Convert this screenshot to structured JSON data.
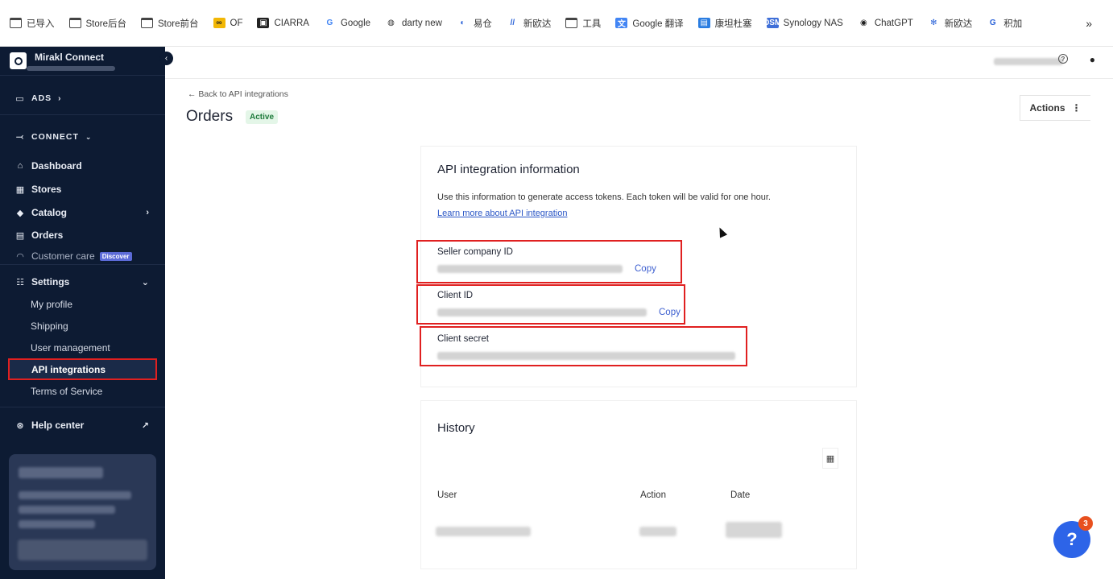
{
  "bookmarks": [
    {
      "label": "已导入",
      "icon": "folder-icon"
    },
    {
      "label": "Store后台",
      "icon": "folder-icon"
    },
    {
      "label": "Store前台",
      "icon": "folder-icon"
    },
    {
      "label": "OF",
      "icon": "of-logo-icon"
    },
    {
      "label": "CIARRA",
      "icon": "ciarra-logo-icon"
    },
    {
      "label": "Google",
      "icon": "google-logo-icon"
    },
    {
      "label": "darty new",
      "icon": "globe-icon"
    },
    {
      "label": "易仓",
      "icon": "yicang-logo-icon"
    },
    {
      "label": "新欧达",
      "icon": "xinouda-logo-icon"
    },
    {
      "label": "工具",
      "icon": "folder-icon"
    },
    {
      "label": "Google 翻译",
      "icon": "google-translate-icon"
    },
    {
      "label": "康坦杜塞",
      "icon": "contact-card-icon"
    },
    {
      "label": "Synology NAS",
      "icon": "synology-logo-icon"
    },
    {
      "label": "ChatGPT",
      "icon": "chatgpt-logo-icon"
    },
    {
      "label": "新欧达",
      "icon": "asterisk-logo-icon"
    },
    {
      "label": "积加",
      "icon": "jijia-logo-icon"
    }
  ],
  "bookmarks_more": "»",
  "brand": {
    "name": "Mirakl Connect"
  },
  "sidebar": {
    "ads": "ADS",
    "connect": "CONNECT",
    "items": [
      {
        "label": "Dashboard",
        "icon": "home-icon"
      },
      {
        "label": "Stores",
        "icon": "store-icon"
      },
      {
        "label": "Catalog",
        "icon": "tag-icon"
      },
      {
        "label": "Orders",
        "icon": "clipboard-icon"
      },
      {
        "label": "Customer care",
        "icon": "headset-icon",
        "badge": "Discover"
      },
      {
        "label": "Settings",
        "icon": "sliders-icon"
      }
    ],
    "settings_sub": [
      "My profile",
      "Shipping",
      "User management",
      "API integrations",
      "Terms of Service"
    ],
    "help": "Help center"
  },
  "page": {
    "back": "← Back to API integrations",
    "title": "Orders",
    "status": "Active",
    "actions": "Actions"
  },
  "api_info": {
    "title": "API integration information",
    "description": "Use this information to generate access tokens. Each token will be valid for one hour.",
    "learn_more": "Learn more about API integration",
    "fields": [
      {
        "label": "Seller company ID",
        "copy": "Copy"
      },
      {
        "label": "Client ID",
        "copy": "Copy"
      },
      {
        "label": "Client secret"
      }
    ]
  },
  "history": {
    "title": "History",
    "columns": [
      "User",
      "Action",
      "Date"
    ]
  },
  "chat": {
    "count": "3"
  },
  "colors": {
    "sidebar_bg": "#0d1b33",
    "link": "#2a56c6",
    "highlight": "#e02020",
    "active_badge_bg": "#e4f6e8",
    "chat_fab": "#2d64e8"
  }
}
